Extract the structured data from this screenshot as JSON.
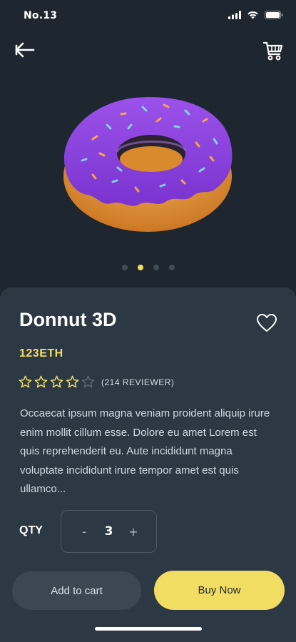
{
  "status": {
    "time": "No.13",
    "icons": [
      "signal-icon",
      "wifi-icon",
      "battery-icon"
    ]
  },
  "nav": {
    "back_icon": "back-arrow-icon",
    "cart_icon": "shopping-cart-icon"
  },
  "carousel": {
    "count": 4,
    "active_index": 1
  },
  "product": {
    "name": "Donnut 3D",
    "price": "123ETH",
    "rating": 4,
    "rating_max": 5,
    "reviewers": "(214 REVIEWER)",
    "description": "Occaecat ipsum magna veniam proident aliquip irure enim mollit cillum esse. Dolore eu amet Lorem est quis reprehenderit eu. Aute incididunt magna voluptate incididunt irure tempor amet est quis ullamco...",
    "favorite_icon": "heart-outline-icon"
  },
  "quantity": {
    "label": "QTY",
    "value": "3",
    "minus": "-",
    "plus": "+"
  },
  "actions": {
    "add_to_cart": "Add to cart",
    "buy_now": "Buy Now"
  },
  "colors": {
    "background": "#1e2730",
    "sheet": "#2c3843",
    "accent": "#f2dd63",
    "icing": "#8a3fd8",
    "dough": "#e59a3a"
  }
}
